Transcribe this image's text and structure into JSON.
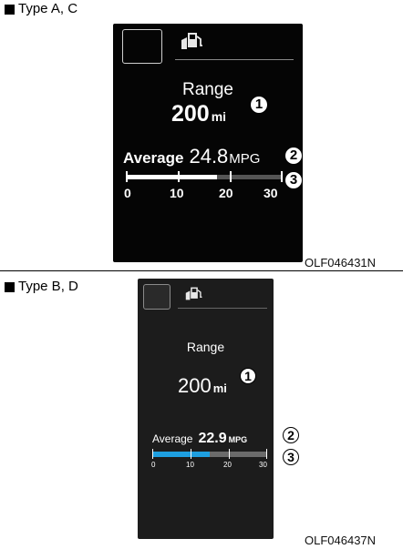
{
  "sections": [
    {
      "type_label": "Type A, C",
      "range_label": "Range",
      "range_value": "200",
      "range_unit": "mi",
      "average_label": "Average",
      "average_value": "24.8",
      "average_unit": "MPG",
      "bar_fill_fraction": 0.58,
      "bar_fill_color": "#ffffff",
      "scale_labels": [
        "0",
        "10",
        "20",
        "30"
      ],
      "callouts": [
        "1",
        "2",
        "3"
      ],
      "image_code": "OLF046431N",
      "icon": "fuel-pump-icon"
    },
    {
      "type_label": "Type B, D",
      "range_label": "Range",
      "range_value": "200",
      "range_unit": "mi",
      "average_label": "Average",
      "average_value": "22.9",
      "average_unit": "MPG",
      "bar_fill_fraction": 0.5,
      "bar_fill_color": "#1e9fe0",
      "scale_labels": [
        "0",
        "10",
        "20",
        "30"
      ],
      "callouts": [
        "1",
        "2",
        "3"
      ],
      "image_code": "OLF046437N",
      "icon": "fuel-pump-icon"
    }
  ]
}
